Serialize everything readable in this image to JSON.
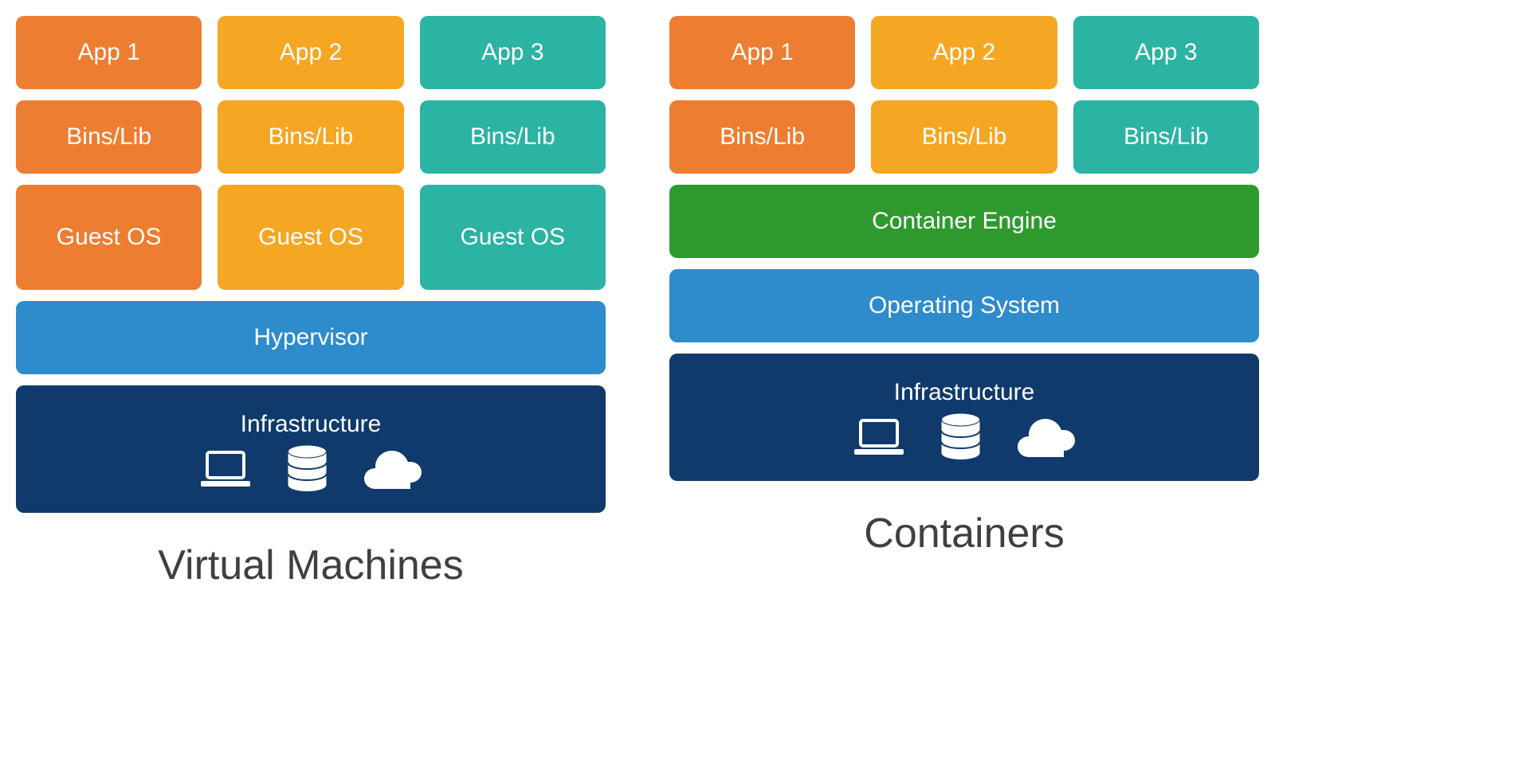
{
  "vm": {
    "title": "Virtual Machines",
    "apps": [
      "App 1",
      "App 2",
      "App 3"
    ],
    "bins": [
      "Bins/Lib",
      "Bins/Lib",
      "Bins/Lib"
    ],
    "guest": [
      "Guest OS",
      "Guest OS",
      "Guest OS"
    ],
    "hypervisor": "Hypervisor",
    "infrastructure": "Infrastructure"
  },
  "containers": {
    "title": "Containers",
    "apps": [
      "App 1",
      "App 2",
      "App 3"
    ],
    "bins": [
      "Bins/Lib",
      "Bins/Lib",
      "Bins/Lib"
    ],
    "engine": "Container Engine",
    "os": "Operating System",
    "infrastructure": "Infrastructure"
  },
  "colors": {
    "orange": "#ed7d31",
    "amber": "#f5a623",
    "teal": "#2bb3a3",
    "blue": "#2e8bcc",
    "navy": "#0f3a6b",
    "green": "#2e9a2e"
  }
}
